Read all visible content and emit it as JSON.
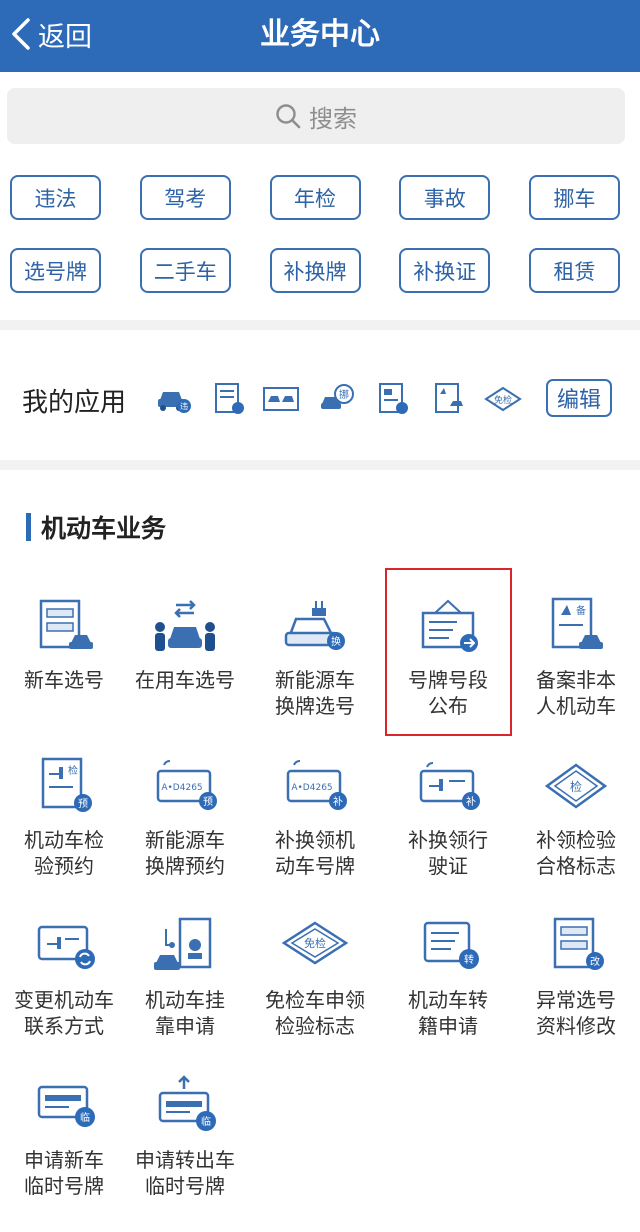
{
  "header": {
    "back_label": "返回",
    "title": "业务中心"
  },
  "search": {
    "placeholder": "搜索"
  },
  "tags": [
    [
      "违法",
      "驾考",
      "年检",
      "事故",
      "挪车"
    ],
    [
      "选号牌",
      "二手车",
      "补换牌",
      "补换证",
      "租赁"
    ]
  ],
  "my_apps": {
    "title": "我的应用",
    "edit_label": "编辑",
    "icons": [
      "car-violation-icon",
      "document-icon",
      "plates-icon",
      "move-car-icon",
      "pre-book-icon",
      "registration-icon",
      "inspection-exempt-icon"
    ]
  },
  "section": {
    "title": "机动车业务"
  },
  "services": [
    {
      "label": "新车选号",
      "icon": "new-plate-icon"
    },
    {
      "label": "在用车选号",
      "icon": "used-car-plate-icon"
    },
    {
      "label": "新能源车\n换牌选号",
      "icon": "ev-plate-icon"
    },
    {
      "label": "号牌号段\n公布",
      "icon": "plate-range-icon"
    },
    {
      "label": "备案非本\n人机动车",
      "icon": "registration-icon"
    },
    {
      "label": "机动车检\n验预约",
      "icon": "inspection-booking-icon"
    },
    {
      "label": "新能源车\n换牌预约",
      "icon": "ev-plate-booking-icon"
    },
    {
      "label": "补换领机\n动车号牌",
      "icon": "replace-plate-icon"
    },
    {
      "label": "补换领行\n驶证",
      "icon": "replace-license-icon"
    },
    {
      "label": "补领检验\n合格标志",
      "icon": "inspection-mark-icon"
    },
    {
      "label": "变更机动车\n联系方式",
      "icon": "change-contact-icon"
    },
    {
      "label": "机动车挂\n靠申请",
      "icon": "affiliation-icon"
    },
    {
      "label": "免检车申领\n检验标志",
      "icon": "exempt-mark-icon"
    },
    {
      "label": "机动车转\n籍申请",
      "icon": "transfer-icon"
    },
    {
      "label": "异常选号\n资料修改",
      "icon": "abnormal-edit-icon"
    },
    {
      "label": "申请新车\n临时号牌",
      "icon": "temp-plate-new-icon"
    },
    {
      "label": "申请转出车\n临时号牌",
      "icon": "temp-plate-out-icon"
    }
  ],
  "colors": {
    "header": "#2d6ab7",
    "accent": "#3a6fb2",
    "highlight": "#d9262c"
  }
}
